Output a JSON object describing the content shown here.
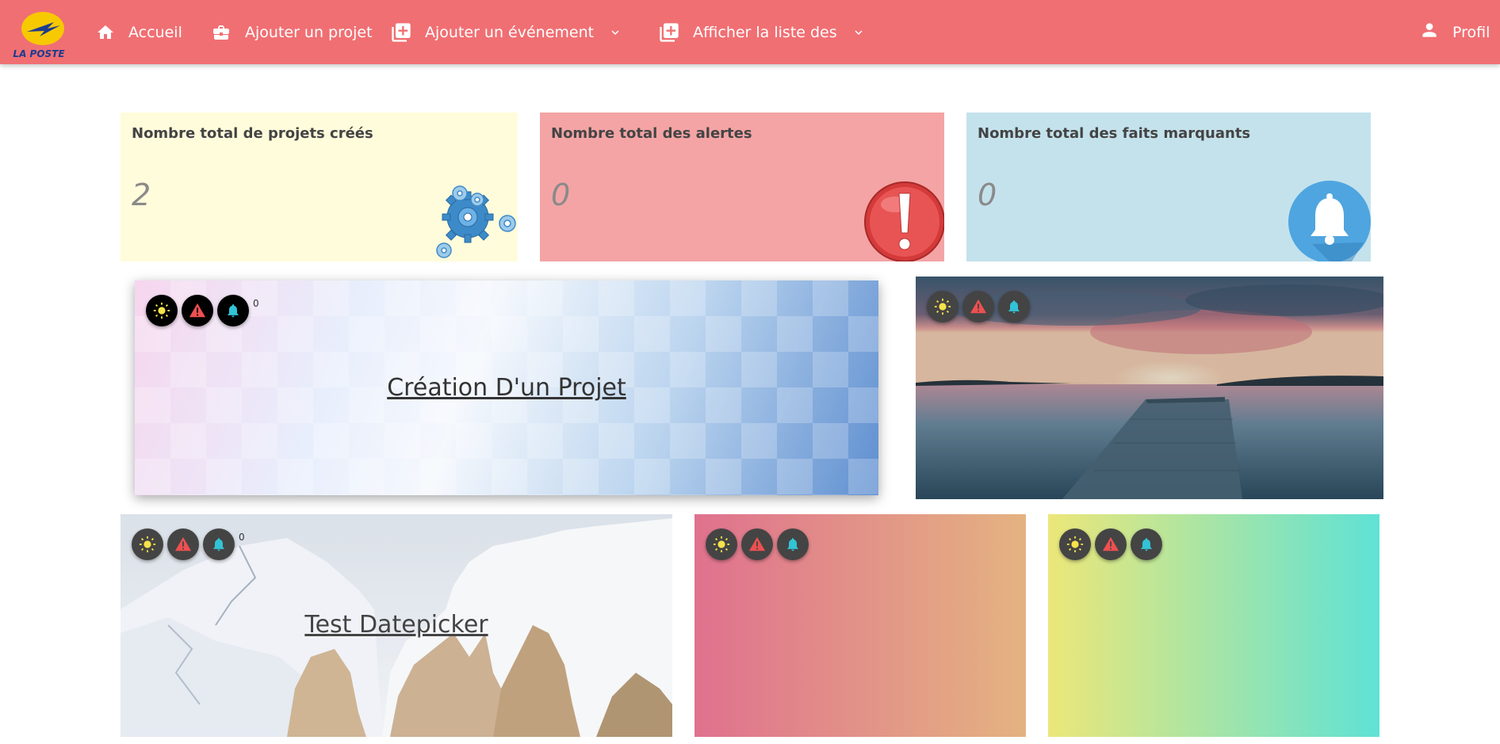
{
  "brand": {
    "logo_text": "LA POSTE"
  },
  "nav": {
    "home": "Accueil",
    "add_project": "Ajouter un projet",
    "add_event": "Ajouter un événement",
    "show_list": "Afficher la liste des",
    "profile": "Profil"
  },
  "stats": [
    {
      "title": "Nombre total de projets créés",
      "value": "2",
      "icon": "gears-icon"
    },
    {
      "title": "Nombre total des alertes",
      "value": "0",
      "icon": "exclamation-icon"
    },
    {
      "title": "Nombre total des faits marquants",
      "value": "0",
      "icon": "bell-icon"
    }
  ],
  "projects": [
    {
      "title": "Création D'un Projet",
      "count": "0",
      "background": "abstract-blue-diamonds"
    },
    {
      "title": "",
      "count": "",
      "background": "lake-sunset-pier"
    },
    {
      "title": "Test Datepicker",
      "count": "0",
      "background": "snowy-mountains"
    },
    {
      "title": "",
      "count": "",
      "background": "pink-orange-gradient"
    },
    {
      "title": "",
      "count": "",
      "background": "yellow-teal-gradient"
    }
  ],
  "colors": {
    "navbar": "#f06f73",
    "stat_projects_bg": "#fffcdb",
    "stat_alerts_bg": "#f4a4a5",
    "stat_highlights_bg": "#c4e2ec",
    "sun": "#f7e24a",
    "alert": "#ee5050",
    "bell": "#33c3d6"
  }
}
